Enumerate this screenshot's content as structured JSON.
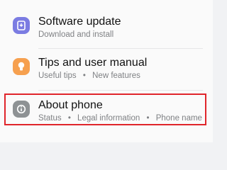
{
  "items": [
    {
      "title": "Software update",
      "subtitle": "Download and install",
      "icon": "software-update-icon",
      "icon_color": "#7b7ce2"
    },
    {
      "title": "Tips and user manual",
      "subtitle_parts": [
        "Useful tips",
        "New features"
      ],
      "icon": "lightbulb-icon",
      "icon_color": "#f6a04f"
    },
    {
      "title": "About phone",
      "subtitle_parts": [
        "Status",
        "Legal information",
        "Phone name"
      ],
      "icon": "info-icon",
      "icon_color": "#8e9294"
    }
  ],
  "separator": "•",
  "highlight_color": "#e0252b"
}
